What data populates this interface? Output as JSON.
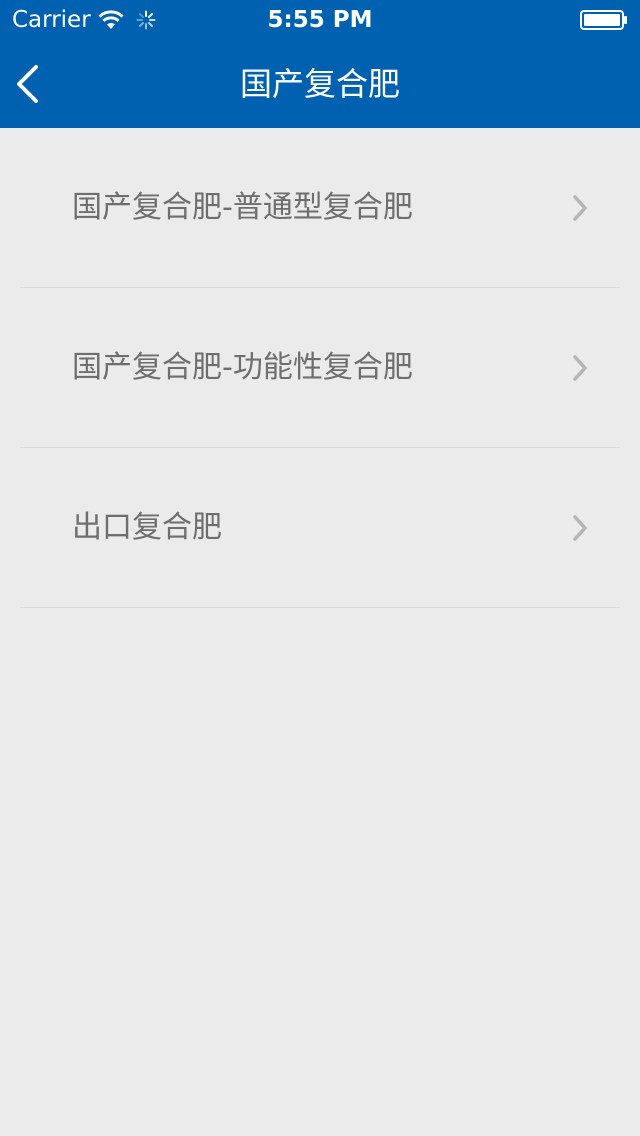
{
  "status_bar": {
    "carrier": "Carrier",
    "time": "5:55 PM"
  },
  "nav_bar": {
    "title": "国产复合肥",
    "back_icon": "chevron-left-icon"
  },
  "list": {
    "items": [
      {
        "label": "国产复合肥-普通型复合肥"
      },
      {
        "label": "国产复合肥-功能性复合肥"
      },
      {
        "label": "出口复合肥"
      }
    ],
    "chevron_icon": "chevron-right-icon"
  },
  "colors": {
    "header_background": "#0061b1",
    "page_background": "#ebebeb",
    "item_text": "#6e6e6e",
    "chevron": "#b4b4b4",
    "divider": "#d9d9d9"
  }
}
